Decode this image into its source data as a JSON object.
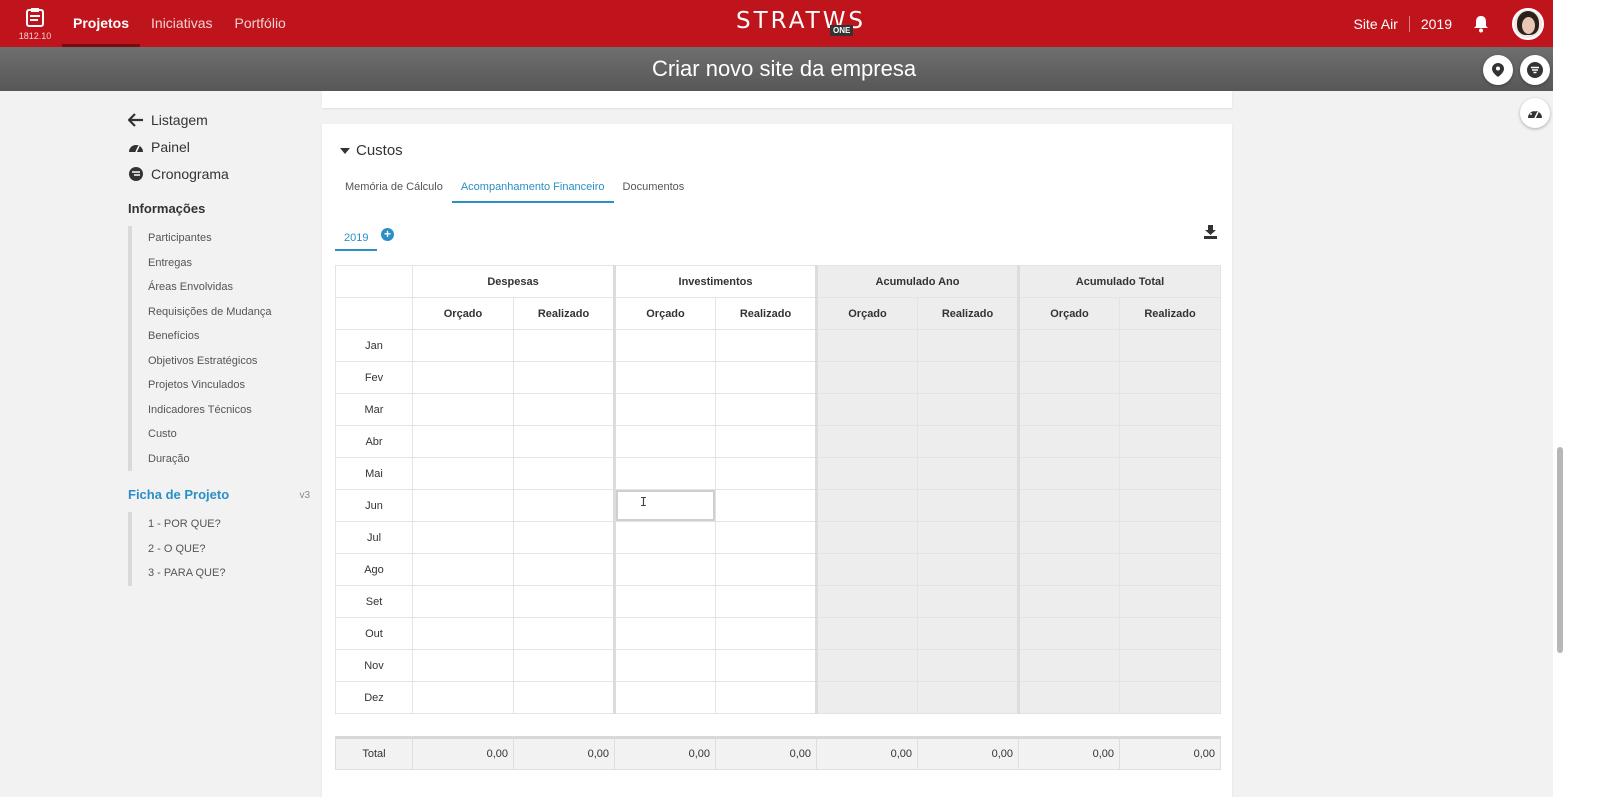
{
  "app": {
    "version": "1812.10",
    "logo_text": "STRATWS",
    "logo_badge": "ONE"
  },
  "nav": {
    "tabs": [
      "Projetos",
      "Iniciativas",
      "Portfólio"
    ],
    "active": "Projetos"
  },
  "header_right": {
    "site": "Site Air",
    "year": "2019"
  },
  "page": {
    "title": "Criar novo site da empresa"
  },
  "sidebar": {
    "links": [
      "Listagem",
      "Painel",
      "Cronograma"
    ],
    "info_title": "Informações",
    "info_items": [
      "Participantes",
      "Entregas",
      "Áreas Envolvidas",
      "Requisições de Mudança",
      "Benefícios",
      "Objetivos Estratégicos",
      "Projetos Vinculados",
      "Indicadores Técnicos",
      "Custo",
      "Duração"
    ],
    "ficha_title": "Ficha de Projeto",
    "ficha_version": "v3",
    "ficha_items": [
      "1 - POR QUE?",
      "2 - O QUE?",
      "3 - PARA QUE?"
    ]
  },
  "costs": {
    "title": "Custos",
    "tabs": [
      "Memória de Cálculo",
      "Acompanhamento Financeiro",
      "Documentos"
    ],
    "active_tab": "Acompanhamento Financeiro",
    "year": "2019",
    "groups": [
      "Despesas",
      "Investimentos",
      "Acumulado Ano",
      "Acumulado Total"
    ],
    "subcols": [
      "Orçado",
      "Realizado",
      "Orçado",
      "Realizado",
      "Orçado",
      "Realizado",
      "Orçado",
      "Realizado"
    ],
    "months": [
      "Jan",
      "Fev",
      "Mar",
      "Abr",
      "Mai",
      "Jun",
      "Jul",
      "Ago",
      "Set",
      "Out",
      "Nov",
      "Dez"
    ],
    "total_label": "Total",
    "totals": [
      "0,00",
      "0,00",
      "0,00",
      "0,00",
      "0,00",
      "0,00",
      "0,00",
      "0,00"
    ]
  },
  "colors": {
    "brand_red": "#c0141c",
    "accent_blue": "#2a8fc4"
  }
}
